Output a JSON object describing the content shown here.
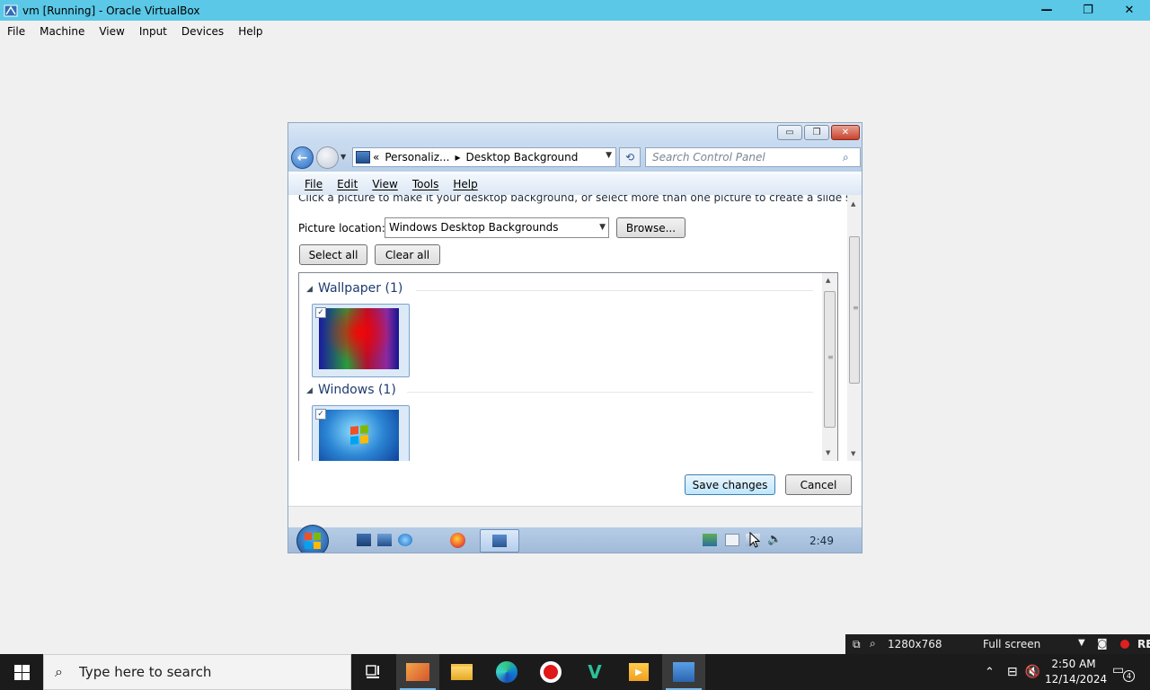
{
  "host_window": {
    "title": "vm [Running] - Oracle VirtualBox",
    "controls": {
      "minimize": "—",
      "restore": "❐",
      "close": "✕"
    },
    "menu": [
      "File",
      "Machine",
      "View",
      "Input",
      "Devices",
      "Help"
    ]
  },
  "guest_window": {
    "controls": {
      "minimize": "▭",
      "maximize": "❐",
      "close": "✕"
    },
    "breadcrumb": {
      "prefix": "«",
      "seg1": "Personaliz...",
      "separator": "▸",
      "seg2": "Desktop Background"
    },
    "search_placeholder": "Search Control Panel",
    "menu": [
      "File",
      "Edit",
      "View",
      "Tools",
      "Help"
    ],
    "intro_text": "Click a picture to make it your desktop background, or select more than one picture to create a slide show.",
    "picture_location_label": "Picture location:",
    "picture_location_value": "Windows Desktop Backgrounds",
    "browse_label": "Browse...",
    "select_all_label": "Select all",
    "clear_all_label": "Clear all",
    "groups": [
      {
        "name": "Wallpaper (1)",
        "thumbnail": "wallpaper",
        "checked": true
      },
      {
        "name": "Windows (1)",
        "thumbnail": "windows",
        "checked": true
      }
    ],
    "save_label": "Save changes",
    "cancel_label": "Cancel",
    "taskbar_clock": "2:49"
  },
  "vbox_status": {
    "resolution": "1280x768",
    "mode": "Full screen",
    "rec": "REC"
  },
  "host_taskbar": {
    "search_placeholder": "Type here to search",
    "time": "2:50 AM",
    "date": "12/14/2024",
    "notification_count": "4"
  },
  "colors": {
    "host_titlebar": "#5ac8e6",
    "aero_blue": "#1e3b70",
    "host_taskbar": "#1b1b1b"
  }
}
